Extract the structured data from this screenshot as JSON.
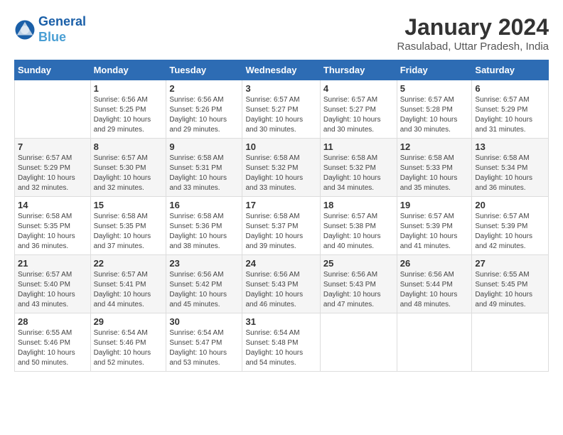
{
  "app": {
    "name1": "General",
    "name2": "Blue"
  },
  "title": "January 2024",
  "subtitle": "Rasulabad, Uttar Pradesh, India",
  "days_of_week": [
    "Sunday",
    "Monday",
    "Tuesday",
    "Wednesday",
    "Thursday",
    "Friday",
    "Saturday"
  ],
  "weeks": [
    [
      {
        "day": "",
        "info": ""
      },
      {
        "day": "1",
        "info": "Sunrise: 6:56 AM\nSunset: 5:25 PM\nDaylight: 10 hours\nand 29 minutes."
      },
      {
        "day": "2",
        "info": "Sunrise: 6:56 AM\nSunset: 5:26 PM\nDaylight: 10 hours\nand 29 minutes."
      },
      {
        "day": "3",
        "info": "Sunrise: 6:57 AM\nSunset: 5:27 PM\nDaylight: 10 hours\nand 30 minutes."
      },
      {
        "day": "4",
        "info": "Sunrise: 6:57 AM\nSunset: 5:27 PM\nDaylight: 10 hours\nand 30 minutes."
      },
      {
        "day": "5",
        "info": "Sunrise: 6:57 AM\nSunset: 5:28 PM\nDaylight: 10 hours\nand 30 minutes."
      },
      {
        "day": "6",
        "info": "Sunrise: 6:57 AM\nSunset: 5:29 PM\nDaylight: 10 hours\nand 31 minutes."
      }
    ],
    [
      {
        "day": "7",
        "info": "Sunrise: 6:57 AM\nSunset: 5:29 PM\nDaylight: 10 hours\nand 32 minutes."
      },
      {
        "day": "8",
        "info": "Sunrise: 6:57 AM\nSunset: 5:30 PM\nDaylight: 10 hours\nand 32 minutes."
      },
      {
        "day": "9",
        "info": "Sunrise: 6:58 AM\nSunset: 5:31 PM\nDaylight: 10 hours\nand 33 minutes."
      },
      {
        "day": "10",
        "info": "Sunrise: 6:58 AM\nSunset: 5:32 PM\nDaylight: 10 hours\nand 33 minutes."
      },
      {
        "day": "11",
        "info": "Sunrise: 6:58 AM\nSunset: 5:32 PM\nDaylight: 10 hours\nand 34 minutes."
      },
      {
        "day": "12",
        "info": "Sunrise: 6:58 AM\nSunset: 5:33 PM\nDaylight: 10 hours\nand 35 minutes."
      },
      {
        "day": "13",
        "info": "Sunrise: 6:58 AM\nSunset: 5:34 PM\nDaylight: 10 hours\nand 36 minutes."
      }
    ],
    [
      {
        "day": "14",
        "info": "Sunrise: 6:58 AM\nSunset: 5:35 PM\nDaylight: 10 hours\nand 36 minutes."
      },
      {
        "day": "15",
        "info": "Sunrise: 6:58 AM\nSunset: 5:35 PM\nDaylight: 10 hours\nand 37 minutes."
      },
      {
        "day": "16",
        "info": "Sunrise: 6:58 AM\nSunset: 5:36 PM\nDaylight: 10 hours\nand 38 minutes."
      },
      {
        "day": "17",
        "info": "Sunrise: 6:58 AM\nSunset: 5:37 PM\nDaylight: 10 hours\nand 39 minutes."
      },
      {
        "day": "18",
        "info": "Sunrise: 6:57 AM\nSunset: 5:38 PM\nDaylight: 10 hours\nand 40 minutes."
      },
      {
        "day": "19",
        "info": "Sunrise: 6:57 AM\nSunset: 5:39 PM\nDaylight: 10 hours\nand 41 minutes."
      },
      {
        "day": "20",
        "info": "Sunrise: 6:57 AM\nSunset: 5:39 PM\nDaylight: 10 hours\nand 42 minutes."
      }
    ],
    [
      {
        "day": "21",
        "info": "Sunrise: 6:57 AM\nSunset: 5:40 PM\nDaylight: 10 hours\nand 43 minutes."
      },
      {
        "day": "22",
        "info": "Sunrise: 6:57 AM\nSunset: 5:41 PM\nDaylight: 10 hours\nand 44 minutes."
      },
      {
        "day": "23",
        "info": "Sunrise: 6:56 AM\nSunset: 5:42 PM\nDaylight: 10 hours\nand 45 minutes."
      },
      {
        "day": "24",
        "info": "Sunrise: 6:56 AM\nSunset: 5:43 PM\nDaylight: 10 hours\nand 46 minutes."
      },
      {
        "day": "25",
        "info": "Sunrise: 6:56 AM\nSunset: 5:43 PM\nDaylight: 10 hours\nand 47 minutes."
      },
      {
        "day": "26",
        "info": "Sunrise: 6:56 AM\nSunset: 5:44 PM\nDaylight: 10 hours\nand 48 minutes."
      },
      {
        "day": "27",
        "info": "Sunrise: 6:55 AM\nSunset: 5:45 PM\nDaylight: 10 hours\nand 49 minutes."
      }
    ],
    [
      {
        "day": "28",
        "info": "Sunrise: 6:55 AM\nSunset: 5:46 PM\nDaylight: 10 hours\nand 50 minutes."
      },
      {
        "day": "29",
        "info": "Sunrise: 6:54 AM\nSunset: 5:46 PM\nDaylight: 10 hours\nand 52 minutes."
      },
      {
        "day": "30",
        "info": "Sunrise: 6:54 AM\nSunset: 5:47 PM\nDaylight: 10 hours\nand 53 minutes."
      },
      {
        "day": "31",
        "info": "Sunrise: 6:54 AM\nSunset: 5:48 PM\nDaylight: 10 hours\nand 54 minutes."
      },
      {
        "day": "",
        "info": ""
      },
      {
        "day": "",
        "info": ""
      },
      {
        "day": "",
        "info": ""
      }
    ]
  ]
}
